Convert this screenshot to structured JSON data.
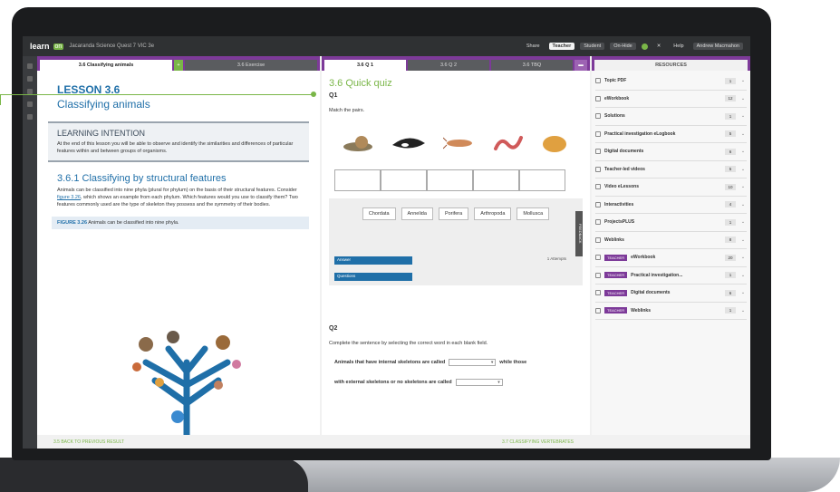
{
  "topbar": {
    "logo": "learn",
    "logo_badge": "on",
    "crumb": "Jacaranda Science Quest 7 VIC 3e",
    "buttons": [
      "Share",
      "Teacher",
      "Student",
      "On-Hide",
      "Help",
      "Andrew Macmahon"
    ]
  },
  "panel1": {
    "tabs": [
      "3.6 Classifying animals",
      "",
      "3.6 Exercise"
    ],
    "lesson_num": "LESSON 3.6",
    "lesson_title": "Classifying animals",
    "intent_heading": "LEARNING INTENTION",
    "intent_text": "At the end of this lesson you will be able to observe and identify the similarities and differences of particular features within and between groups of organisms.",
    "section_heading": "3.6.1 Classifying by structural features",
    "section_text_a": "Animals can be classified into nine phyla (plural for phylum) on the basis of their structural features. Consider ",
    "section_link": "figure 3.26",
    "section_text_b": ", which shows an example from each phylum. Which features would you use to classify them? Two features commonly used are the type of skeleton they possess and the symmetry of their bodies.",
    "figure_label": "FIGURE 3.26",
    "figure_caption": "Animals can be classified into nine phyla."
  },
  "panel2": {
    "tabs": [
      "3.6 Q 1",
      "3.6 Q 2",
      "3.6 TBQ",
      ""
    ],
    "quiz_heading": "3.6 Quick quiz",
    "q1_label": "Q1",
    "q1_text": "Match the pairs.",
    "chips": [
      "Chordata",
      "Annelida",
      "Porifera",
      "Arthropoda",
      "Mollusca"
    ],
    "dropdown1": "Answer",
    "dropdown2": "Questions",
    "attempts": "1 Attempts",
    "side_handle": "FEEDBACK",
    "q2_label": "Q2",
    "q2_text": "Complete the sentence by selecting the correct word in each blank field.",
    "q2_sentence_a": "Animals that have internal skeletons are called",
    "q2_sentence_b": "while those",
    "q2_sentence_c": "with external skeletons or no skeletons are called"
  },
  "footer": {
    "back": "3.5 BACK TO PREVIOUS RESULT",
    "next": "3.7 CLASSIFYING VERTEBRATES"
  },
  "resources": {
    "heading": "RESOURCES",
    "items": [
      {
        "name": "Topic PDF",
        "count": "1",
        "badge": ""
      },
      {
        "name": "eWorkbook",
        "count": "12",
        "badge": ""
      },
      {
        "name": "Solutions",
        "count": "1",
        "badge": ""
      },
      {
        "name": "Practical investigation eLogbook",
        "count": "5",
        "badge": ""
      },
      {
        "name": "Digital documents",
        "count": "6",
        "badge": ""
      },
      {
        "name": "Teacher-led videos",
        "count": "5",
        "badge": ""
      },
      {
        "name": "Video eLessons",
        "count": "10",
        "badge": ""
      },
      {
        "name": "Interactivities",
        "count": "4",
        "badge": ""
      },
      {
        "name": "ProjectsPLUS",
        "count": "1",
        "badge": ""
      },
      {
        "name": "Weblinks",
        "count": "8",
        "badge": ""
      },
      {
        "name": "eWorkbook",
        "count": "20",
        "badge": "TEACHER"
      },
      {
        "name": "Practical investigation...",
        "count": "1",
        "badge": "TEACHER"
      },
      {
        "name": "Digital documents",
        "count": "6",
        "badge": "TEACHER"
      },
      {
        "name": "Weblinks",
        "count": "1",
        "badge": "TEACHER"
      }
    ]
  },
  "colors": {
    "purple": "#7d3a99",
    "green": "#7ab648",
    "blue": "#1f6fa8"
  }
}
